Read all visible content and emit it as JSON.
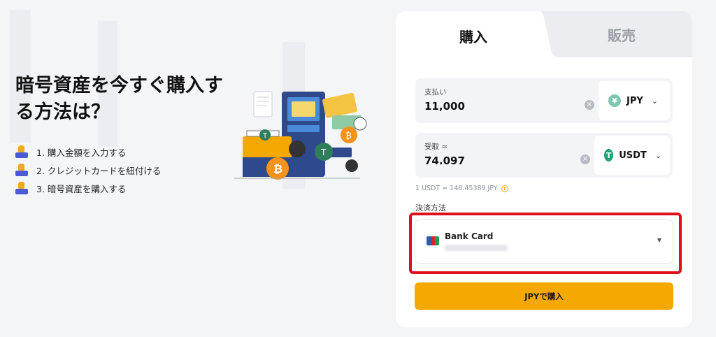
{
  "hero": {
    "title": "暗号資産を今すぐ購入する方法は？",
    "steps": [
      {
        "label": "1. 購入金額を入力する"
      },
      {
        "label": "2. クレジットカードを紐付ける"
      },
      {
        "label": "3. 暗号資産を購入する"
      }
    ]
  },
  "card": {
    "tabs": {
      "buy": "購入",
      "sell": "販売"
    },
    "pay": {
      "label": "支払い",
      "value": "11,000",
      "currency": "JPY",
      "currency_icon": "¥",
      "icon_color": "#7fc6b0"
    },
    "receive": {
      "label": "受取 ≈",
      "value": "74.097",
      "currency": "USDT",
      "currency_icon": "T",
      "icon_color": "#26a17b"
    },
    "rate": "1 USDT ≈ 148.45389 JPY",
    "payment_method": {
      "label": "決済方法",
      "title": "Bank Card"
    },
    "buy_button": "JPYで購入"
  },
  "colors": {
    "accent": "#f5a800",
    "highlight": "#e0101a"
  }
}
